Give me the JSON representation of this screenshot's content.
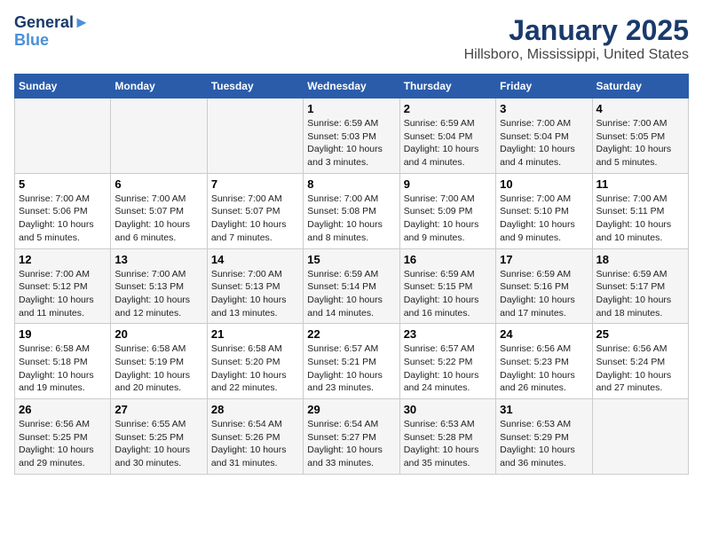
{
  "header": {
    "logo_line1": "General",
    "logo_line2": "Blue",
    "title": "January 2025",
    "subtitle": "Hillsboro, Mississippi, United States"
  },
  "days_of_week": [
    "Sunday",
    "Monday",
    "Tuesday",
    "Wednesday",
    "Thursday",
    "Friday",
    "Saturday"
  ],
  "weeks": [
    [
      {
        "num": "",
        "info": ""
      },
      {
        "num": "",
        "info": ""
      },
      {
        "num": "",
        "info": ""
      },
      {
        "num": "1",
        "info": "Sunrise: 6:59 AM\nSunset: 5:03 PM\nDaylight: 10 hours\nand 3 minutes."
      },
      {
        "num": "2",
        "info": "Sunrise: 6:59 AM\nSunset: 5:04 PM\nDaylight: 10 hours\nand 4 minutes."
      },
      {
        "num": "3",
        "info": "Sunrise: 7:00 AM\nSunset: 5:04 PM\nDaylight: 10 hours\nand 4 minutes."
      },
      {
        "num": "4",
        "info": "Sunrise: 7:00 AM\nSunset: 5:05 PM\nDaylight: 10 hours\nand 5 minutes."
      }
    ],
    [
      {
        "num": "5",
        "info": "Sunrise: 7:00 AM\nSunset: 5:06 PM\nDaylight: 10 hours\nand 5 minutes."
      },
      {
        "num": "6",
        "info": "Sunrise: 7:00 AM\nSunset: 5:07 PM\nDaylight: 10 hours\nand 6 minutes."
      },
      {
        "num": "7",
        "info": "Sunrise: 7:00 AM\nSunset: 5:07 PM\nDaylight: 10 hours\nand 7 minutes."
      },
      {
        "num": "8",
        "info": "Sunrise: 7:00 AM\nSunset: 5:08 PM\nDaylight: 10 hours\nand 8 minutes."
      },
      {
        "num": "9",
        "info": "Sunrise: 7:00 AM\nSunset: 5:09 PM\nDaylight: 10 hours\nand 9 minutes."
      },
      {
        "num": "10",
        "info": "Sunrise: 7:00 AM\nSunset: 5:10 PM\nDaylight: 10 hours\nand 9 minutes."
      },
      {
        "num": "11",
        "info": "Sunrise: 7:00 AM\nSunset: 5:11 PM\nDaylight: 10 hours\nand 10 minutes."
      }
    ],
    [
      {
        "num": "12",
        "info": "Sunrise: 7:00 AM\nSunset: 5:12 PM\nDaylight: 10 hours\nand 11 minutes."
      },
      {
        "num": "13",
        "info": "Sunrise: 7:00 AM\nSunset: 5:13 PM\nDaylight: 10 hours\nand 12 minutes."
      },
      {
        "num": "14",
        "info": "Sunrise: 7:00 AM\nSunset: 5:13 PM\nDaylight: 10 hours\nand 13 minutes."
      },
      {
        "num": "15",
        "info": "Sunrise: 6:59 AM\nSunset: 5:14 PM\nDaylight: 10 hours\nand 14 minutes."
      },
      {
        "num": "16",
        "info": "Sunrise: 6:59 AM\nSunset: 5:15 PM\nDaylight: 10 hours\nand 16 minutes."
      },
      {
        "num": "17",
        "info": "Sunrise: 6:59 AM\nSunset: 5:16 PM\nDaylight: 10 hours\nand 17 minutes."
      },
      {
        "num": "18",
        "info": "Sunrise: 6:59 AM\nSunset: 5:17 PM\nDaylight: 10 hours\nand 18 minutes."
      }
    ],
    [
      {
        "num": "19",
        "info": "Sunrise: 6:58 AM\nSunset: 5:18 PM\nDaylight: 10 hours\nand 19 minutes."
      },
      {
        "num": "20",
        "info": "Sunrise: 6:58 AM\nSunset: 5:19 PM\nDaylight: 10 hours\nand 20 minutes."
      },
      {
        "num": "21",
        "info": "Sunrise: 6:58 AM\nSunset: 5:20 PM\nDaylight: 10 hours\nand 22 minutes."
      },
      {
        "num": "22",
        "info": "Sunrise: 6:57 AM\nSunset: 5:21 PM\nDaylight: 10 hours\nand 23 minutes."
      },
      {
        "num": "23",
        "info": "Sunrise: 6:57 AM\nSunset: 5:22 PM\nDaylight: 10 hours\nand 24 minutes."
      },
      {
        "num": "24",
        "info": "Sunrise: 6:56 AM\nSunset: 5:23 PM\nDaylight: 10 hours\nand 26 minutes."
      },
      {
        "num": "25",
        "info": "Sunrise: 6:56 AM\nSunset: 5:24 PM\nDaylight: 10 hours\nand 27 minutes."
      }
    ],
    [
      {
        "num": "26",
        "info": "Sunrise: 6:56 AM\nSunset: 5:25 PM\nDaylight: 10 hours\nand 29 minutes."
      },
      {
        "num": "27",
        "info": "Sunrise: 6:55 AM\nSunset: 5:25 PM\nDaylight: 10 hours\nand 30 minutes."
      },
      {
        "num": "28",
        "info": "Sunrise: 6:54 AM\nSunset: 5:26 PM\nDaylight: 10 hours\nand 31 minutes."
      },
      {
        "num": "29",
        "info": "Sunrise: 6:54 AM\nSunset: 5:27 PM\nDaylight: 10 hours\nand 33 minutes."
      },
      {
        "num": "30",
        "info": "Sunrise: 6:53 AM\nSunset: 5:28 PM\nDaylight: 10 hours\nand 35 minutes."
      },
      {
        "num": "31",
        "info": "Sunrise: 6:53 AM\nSunset: 5:29 PM\nDaylight: 10 hours\nand 36 minutes."
      },
      {
        "num": "",
        "info": ""
      }
    ]
  ]
}
